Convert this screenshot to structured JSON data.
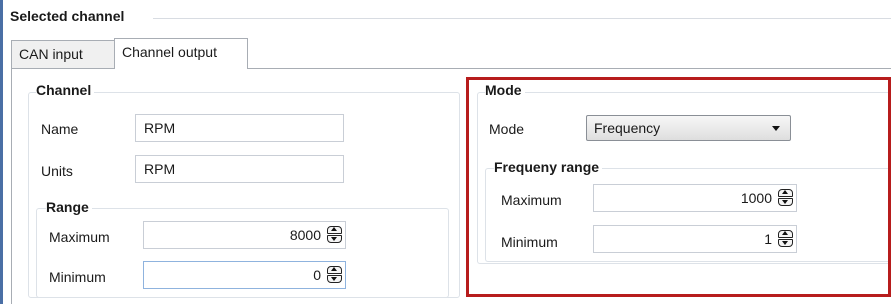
{
  "window": {
    "group_title": "Selected channel"
  },
  "tabs": [
    {
      "label": "CAN input",
      "active": false
    },
    {
      "label": "Channel output",
      "active": true
    }
  ],
  "channel": {
    "title": "Channel",
    "name_label": "Name",
    "name_value": "RPM",
    "units_label": "Units",
    "units_value": "RPM",
    "range": {
      "title": "Range",
      "maximum_label": "Maximum",
      "maximum_value": "8000",
      "minimum_label": "Minimum",
      "minimum_value": "0"
    }
  },
  "mode": {
    "title": "Mode",
    "mode_label": "Mode",
    "mode_value": "Frequency",
    "frequency_range": {
      "title": "Frequeny range",
      "maximum_label": "Maximum",
      "maximum_value": "1000",
      "minimum_label": "Minimum",
      "minimum_value": "1"
    }
  },
  "colors": {
    "window_border": "#4a6fa5",
    "highlight": "#b71c1c",
    "focus_border": "#8fb3de"
  }
}
